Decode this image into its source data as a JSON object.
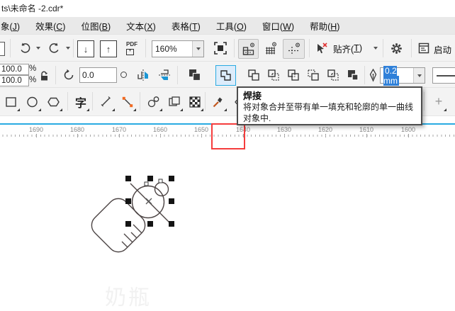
{
  "window": {
    "title": "ts\\未命名 -2.cdr*"
  },
  "menu": {
    "items": [
      {
        "pre": "象(",
        "key": "J",
        "post": ")"
      },
      {
        "pre": "效果(",
        "key": "C",
        "post": ")"
      },
      {
        "pre": "位图(",
        "key": "B",
        "post": ")"
      },
      {
        "pre": "文本(",
        "key": "X",
        "post": ")"
      },
      {
        "pre": "表格(",
        "key": "T",
        "post": ")"
      },
      {
        "pre": "工具(",
        "key": "O",
        "post": ")"
      },
      {
        "pre": "窗口(",
        "key": "W",
        "post": ")"
      },
      {
        "pre": "帮助(",
        "key": "H",
        "post": ")"
      }
    ]
  },
  "standard_toolbar": {
    "zoom_value": "160%",
    "pdf_label": "PDF",
    "snap": {
      "pre": "贴齐(",
      "key": "T",
      "post": ")"
    },
    "launch_label": "启动",
    "icons": [
      "undo-icon",
      "redo-icon",
      "import-icon",
      "export-icon",
      "pdf-icon",
      "zoom-combobox",
      "fullscreen-icon",
      "rulers-icon",
      "grid-icon",
      "guidelines-icon",
      "snap-off-icon",
      "options-gear-icon",
      "launcher-icon"
    ]
  },
  "property_bar": {
    "scale_x": "100.0",
    "scale_y": "100.0",
    "percent": "%",
    "rotation_angle": "0.0",
    "outline_width": "0.2 mm",
    "icons": [
      "lock-ratio-icon",
      "rotation-icon",
      "mirror-horizontal-icon",
      "mirror-vertical-icon",
      "combine-icon",
      "weld-icon",
      "trim-icon",
      "intersect-icon",
      "simplify-icon",
      "front-minus-back-icon",
      "back-minus-front-icon",
      "create-boundary-icon",
      "outline-pen-icon",
      "outline-style-preview"
    ]
  },
  "toolbox": {
    "text_tool_glyph": "字",
    "add_label": "+",
    "icons": [
      "rectangle-tool-icon",
      "ellipse-tool-icon",
      "polygon-tool-icon",
      "text-tool-icon",
      "line-tool-icon",
      "bezier-tool-icon",
      "blend-tool-icon",
      "transparency-tool-icon",
      "pattern-fill-tool-icon",
      "eyedropper-tool-icon",
      "attributes-eyedropper-icon",
      "add-tool-icon"
    ]
  },
  "tooltip": {
    "title": "焊接",
    "description": "将对象合并至带有单一填充和轮廓的单一曲线对象中."
  },
  "ruler": {
    "labels": [
      "1690",
      "1680",
      "1670",
      "1660",
      "1650",
      "1640",
      "1630",
      "1620",
      "1610",
      "1600"
    ]
  },
  "canvas": {
    "watermark": "奶瓶"
  },
  "colors": {
    "accent_blue": "#29abe2",
    "selection_blue": "#2f80d9",
    "annotation_red": "#f53d3d",
    "weld_button_bg": "#dcecfb",
    "toolbar_bg": "#f3f3f3",
    "menubar_bg": "#e9e9e9",
    "drawing_stroke": "#4d4545"
  }
}
